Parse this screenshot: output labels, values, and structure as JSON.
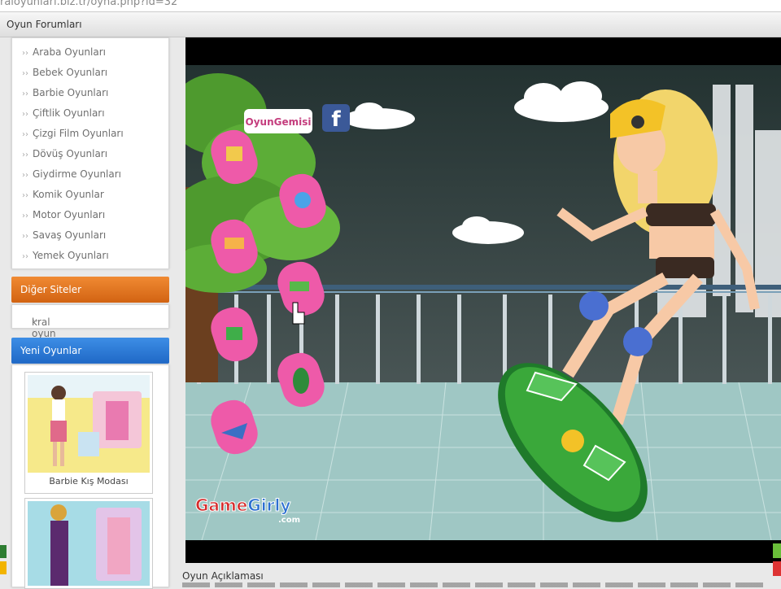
{
  "browser": {
    "url": "raloyunlari.biz.tr/oyna.php?id=32"
  },
  "topnav": {
    "forum_label": "Oyun Forumları"
  },
  "sidebar": {
    "categories": [
      "Araba Oyunları",
      "Bebek Oyunları",
      "Barbie Oyunları",
      "Çiftlik Oyunları",
      "Çizgi Film Oyunları",
      "Dövüş Oyunları",
      "Giydirme Oyunları",
      "Komik Oyunlar",
      "Motor Oyunları",
      "Savaş Oyunları",
      "Yemek Oyunları"
    ],
    "other_sites_title": "Diğer Siteler",
    "other_sites": [
      "kral oyun"
    ],
    "new_games_title": "Yeni Oyunlar",
    "new_games": [
      "Barbie Kış Modası"
    ]
  },
  "game": {
    "oyun_gemisi_logo": "OyunGemisi",
    "gamegirly_logo_a": "Game",
    "gamegirly_logo_b": "Girly",
    "gamegirly_logo_c": ".com",
    "facebook_glyph": "f"
  },
  "description": {
    "title": "Oyun Açıklaması"
  },
  "colors": {
    "orange_header": "#e0741f",
    "blue_header": "#2b7bd6",
    "sky": "#2d3e3d",
    "nail_pink": "#ee5aa9",
    "board_green": "#3aa83a"
  }
}
